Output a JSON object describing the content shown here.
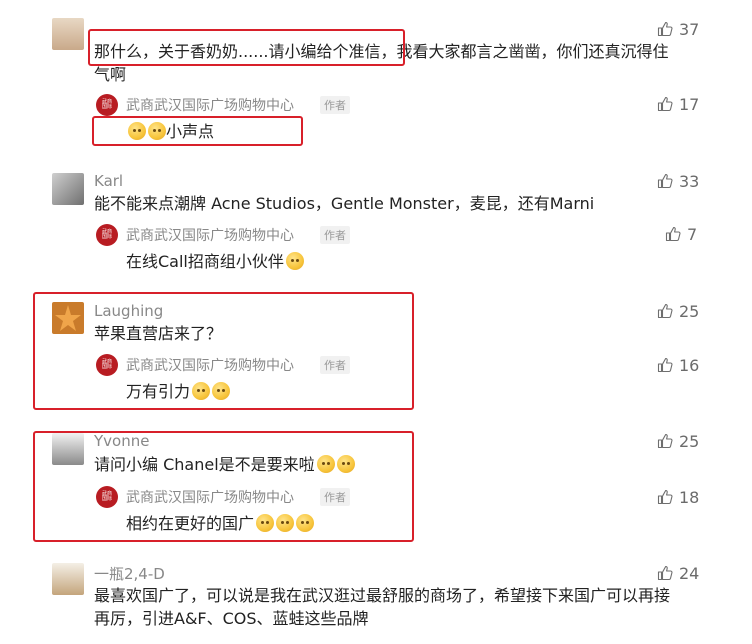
{
  "comments": [
    {
      "nickname": "",
      "text_line1": "那什么，关于香奶奶......请小编给个准信，我看大家都言之凿凿，你们还真沉得住",
      "text_line2": "气啊",
      "likes": "37",
      "reply": {
        "author": "武商武汉国际广场购物中心",
        "tag": "作者",
        "text": "小声点",
        "likes": "17"
      }
    },
    {
      "nickname": "Karl",
      "text_line1": "能不能来点潮牌 Acne Studios，Gentle Monster，麦昆，还有Marni",
      "likes": "33",
      "reply": {
        "author": "武商武汉国际广场购物中心",
        "tag": "作者",
        "text": "在线Call招商组小伙伴",
        "likes": "7"
      }
    },
    {
      "nickname": "Laughing",
      "text_line1": "苹果直营店来了？",
      "likes": "25",
      "reply": {
        "author": "武商武汉国际广场购物中心",
        "tag": "作者",
        "text": "万有引力",
        "likes": "16"
      }
    },
    {
      "nickname": "Yvonne",
      "text_line1": "请问小编 Chanel是不是要来啦",
      "likes": "25",
      "reply": {
        "author": "武商武汉国际广场购物中心",
        "tag": "作者",
        "text": "相约在更好的国广",
        "likes": "18"
      }
    },
    {
      "nickname": "一瓶2,4-D",
      "text_line1": "最喜欢国广了，可以说是我在武汉逛过最舒服的商场了，希望接下来国广可以再接",
      "text_line2": "再厉，引进A&F、COS、蓝蛙这些品牌",
      "likes": "24"
    }
  ],
  "icons": {
    "like": "thumbs-up-icon",
    "logo": "wushang-logo",
    "emoji": "face-emoji"
  },
  "colors": {
    "highlight_box": "#d8202a",
    "logo_red": "#b81c22",
    "muted": "#888888"
  }
}
